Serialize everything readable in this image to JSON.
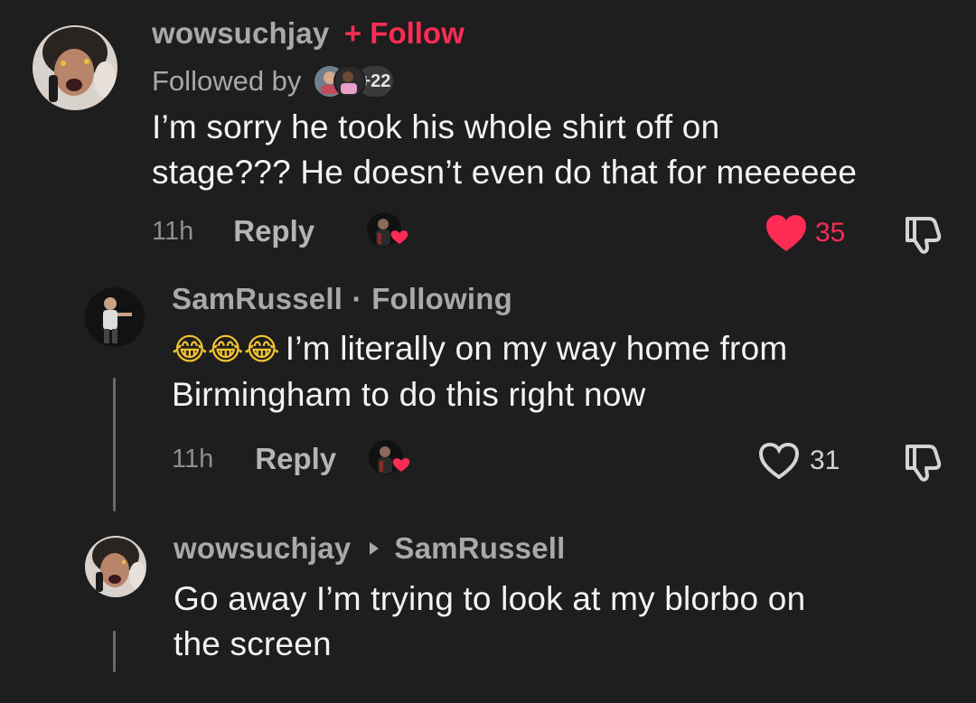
{
  "comments": [
    {
      "username": "wowsuchjay",
      "follow_label": "+ Follow",
      "followed_by_label": "Followed by",
      "followed_by_extra": "+22",
      "text_line1": "I’m sorry he took his whole shirt off on",
      "text_line2": "stage??? He doesn’t even do that for meeeeee",
      "time": "11h",
      "reply_label": "Reply",
      "likes": "35",
      "liked": true
    },
    {
      "username": "SamRussell",
      "separator": "·",
      "following_label": "Following",
      "emojis": "😂😂😂",
      "text_line1": "I’m literally on my way home from",
      "text_line2": "Birmingham to do this right now",
      "time": "11h",
      "reply_label": "Reply",
      "likes": "31",
      "liked": false
    },
    {
      "username": "wowsuchjay",
      "reply_to": "SamRussell",
      "text_line1": "Go away I’m trying to look at my blorbo on",
      "text_line2": "the screen"
    }
  ],
  "colors": {
    "background": "#1e1e1f",
    "accent": "#fe2c55",
    "muted": "#a9a9ab"
  },
  "icons": [
    "avatar",
    "heart-icon",
    "dislike-icon",
    "creator-liked-badge",
    "reply-arrow-icon"
  ]
}
